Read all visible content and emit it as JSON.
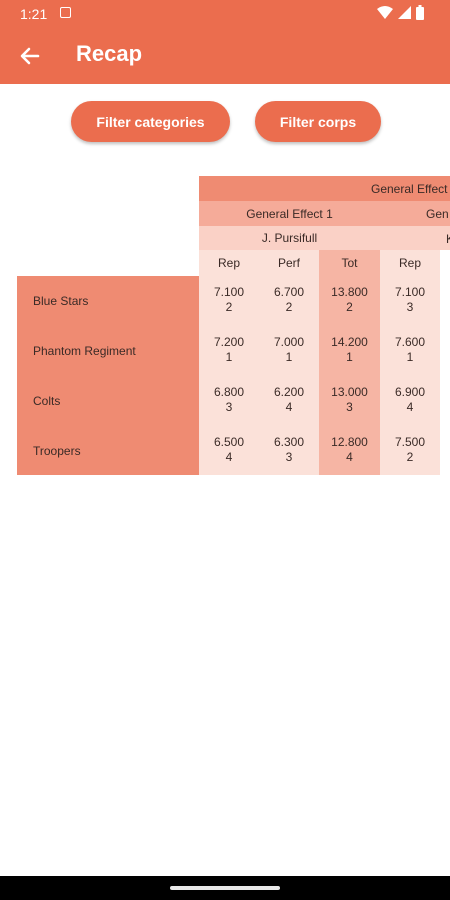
{
  "status": {
    "time": "1:21"
  },
  "appbar": {
    "title": "Recap"
  },
  "filters": {
    "categories": "Filter categories",
    "corps": "Filter corps"
  },
  "table": {
    "header1": "General Effect",
    "header2": [
      "General Effect 1",
      "Gen"
    ],
    "header3": [
      "J. Pursifull",
      "K"
    ],
    "columns": [
      "Rep",
      "Perf",
      "Tot",
      "Rep"
    ],
    "rows": [
      {
        "corps": "Blue Stars",
        "values": [
          [
            "7.100",
            "2"
          ],
          [
            "6.700",
            "2"
          ],
          [
            "13.800",
            "2"
          ],
          [
            "7.100",
            "3"
          ]
        ]
      },
      {
        "corps": "Phantom Regiment",
        "values": [
          [
            "7.200",
            "1"
          ],
          [
            "7.000",
            "1"
          ],
          [
            "14.200",
            "1"
          ],
          [
            "7.600",
            "1"
          ]
        ]
      },
      {
        "corps": "Colts",
        "values": [
          [
            "6.800",
            "3"
          ],
          [
            "6.200",
            "4"
          ],
          [
            "13.000",
            "3"
          ],
          [
            "6.900",
            "4"
          ]
        ]
      },
      {
        "corps": "Troopers",
        "values": [
          [
            "6.500",
            "4"
          ],
          [
            "6.300",
            "3"
          ],
          [
            "12.800",
            "4"
          ],
          [
            "7.500",
            "2"
          ]
        ]
      }
    ]
  }
}
